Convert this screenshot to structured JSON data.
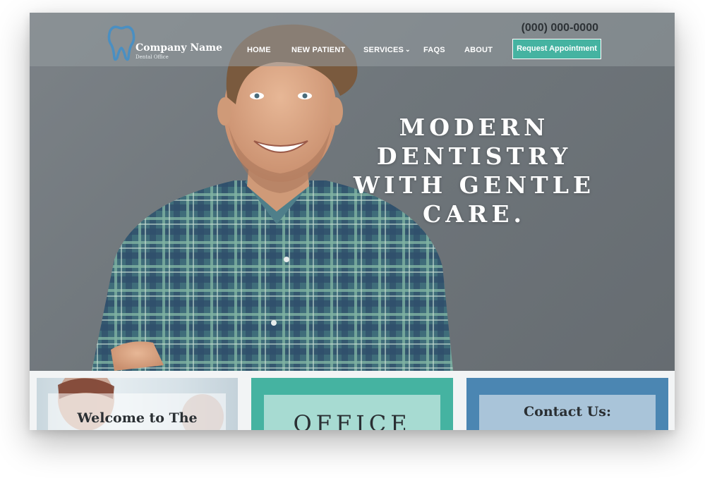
{
  "brand": {
    "company_name": "Company Name",
    "tagline": "Dental Office",
    "logo_icon": "tooth-icon",
    "accent_color": "#45b3a1",
    "secondary_color": "#4b86b2"
  },
  "header": {
    "phone": "(000) 000-0000",
    "nav": [
      {
        "label": "HOME"
      },
      {
        "label": "NEW PATIENT"
      },
      {
        "label": "SERVICES",
        "icon": "chevron-down-icon"
      },
      {
        "label": "FAQS"
      },
      {
        "label": "ABOUT"
      }
    ],
    "cta_label": "Request Appointment"
  },
  "hero": {
    "headline_lines": [
      "MODERN",
      "DENTISTRY",
      "WITH GENTLE",
      "CARE."
    ]
  },
  "panels": {
    "welcome_title": "Welcome to The",
    "office_title": "OFFICE",
    "contact_title": "Contact Us:"
  }
}
